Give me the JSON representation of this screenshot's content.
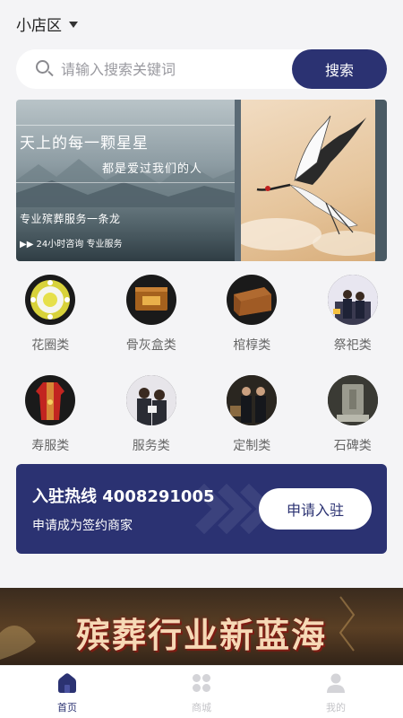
{
  "header": {
    "location_label": "小店区"
  },
  "search": {
    "placeholder": "请输入搜索关键词",
    "button_label": "搜索"
  },
  "banner": {
    "line1": "天上的每一颗星星",
    "line2": "都是爱过我们的人",
    "line3": "专业殡葬服务一条龙",
    "line4": "▶▶ 24小时咨询 专业服务"
  },
  "categories": [
    {
      "label": "花圈类",
      "icon": "wreath-icon"
    },
    {
      "label": "骨灰盒类",
      "icon": "urn-box-icon"
    },
    {
      "label": "棺椁类",
      "icon": "coffin-icon"
    },
    {
      "label": "祭祀类",
      "icon": "memorial-ceremony-icon"
    },
    {
      "label": "寿服类",
      "icon": "burial-clothes-icon"
    },
    {
      "label": "服务类",
      "icon": "service-staff-icon"
    },
    {
      "label": "定制类",
      "icon": "custom-service-icon"
    },
    {
      "label": "石碑类",
      "icon": "tombstone-icon"
    }
  ],
  "hotline": {
    "title": "入驻热线 4008291005",
    "subtitle": "申请成为签约商家",
    "button_label": "申请入驻"
  },
  "promo": {
    "headline": "殡葬行业新蓝海"
  },
  "tabbar": {
    "items": [
      {
        "label": "首页",
        "active": true
      },
      {
        "label": "商城",
        "active": false
      },
      {
        "label": "我的",
        "active": false
      }
    ]
  },
  "colors": {
    "brand": "#2b3272",
    "background": "#f4f4f6"
  }
}
